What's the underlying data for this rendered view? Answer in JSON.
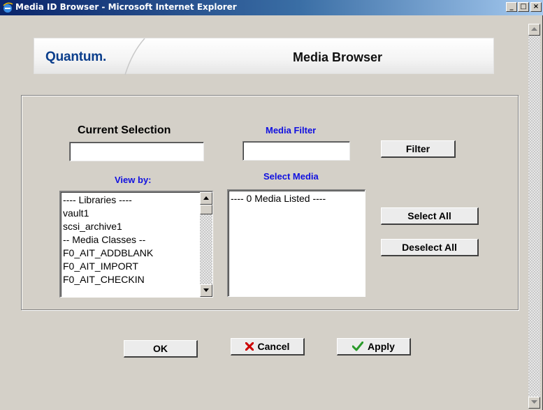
{
  "window": {
    "title": "Media ID Browser - Microsoft Internet Explorer",
    "minimize": "_",
    "maximize": "□",
    "close": "×"
  },
  "header": {
    "logo": "Quantum.",
    "title": "Media Browser"
  },
  "current_selection": {
    "label": "Current Selection",
    "value": ""
  },
  "media_filter": {
    "label": "Media Filter",
    "value": "",
    "button": "Filter"
  },
  "view_by": {
    "label": "View by:",
    "items": [
      "---- Libraries ----",
      "vault1",
      "scsi_archive1",
      "-- Media Classes --",
      "F0_AIT_ADDBLANK",
      "F0_AIT_IMPORT",
      "F0_AIT_CHECKIN"
    ]
  },
  "select_media": {
    "label": "Select Media",
    "items": [
      "---- 0 Media Listed ----"
    ]
  },
  "buttons": {
    "select_all": "Select All",
    "deselect_all": "Deselect All",
    "ok": "OK",
    "cancel": "Cancel",
    "apply": "Apply"
  },
  "colors": {
    "accent_blue": "#1010e0",
    "logo_blue": "#0b3e8c",
    "cancel_red": "#cc0000",
    "apply_green": "#2a9a2a"
  }
}
